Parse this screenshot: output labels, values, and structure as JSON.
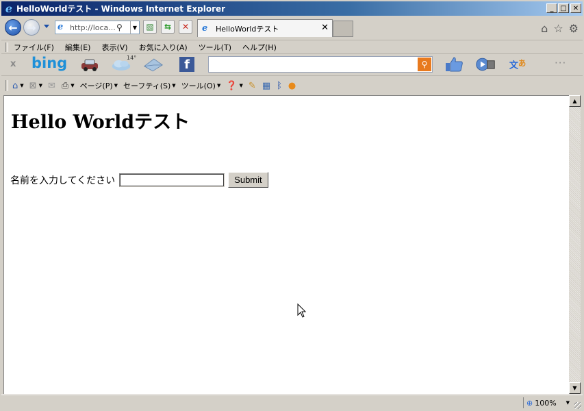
{
  "window": {
    "title": "HelloWorldテスト - Windows Internet Explorer",
    "minimize": "_",
    "maximize": "□",
    "close": "✕"
  },
  "nav": {
    "address": "http://loca...",
    "tab_label": "HelloWorldテスト",
    "tab_close": "✕"
  },
  "menu": {
    "items": [
      "ファイル(F)",
      "編集(E)",
      "表示(V)",
      "お気に入り(A)",
      "ツール(T)",
      "ヘルプ(H)"
    ]
  },
  "toolbar": {
    "close": "x",
    "bing": "bing",
    "weather_temp": "14°",
    "facebook": "f",
    "search_value": "",
    "more": "···"
  },
  "commandbar": {
    "page": "ページ(P)",
    "safety": "セーフティ(S)",
    "tools": "ツール(O)"
  },
  "page": {
    "heading": "Hello Worldテスト",
    "name_label": "名前を入力してください",
    "name_value": "",
    "submit_label": "Submit"
  },
  "status": {
    "zoom": "100%"
  },
  "colors": {
    "titlebar_start": "#0a246a",
    "bing_blue": "#1e90d8",
    "facebook_blue": "#3b5998"
  }
}
